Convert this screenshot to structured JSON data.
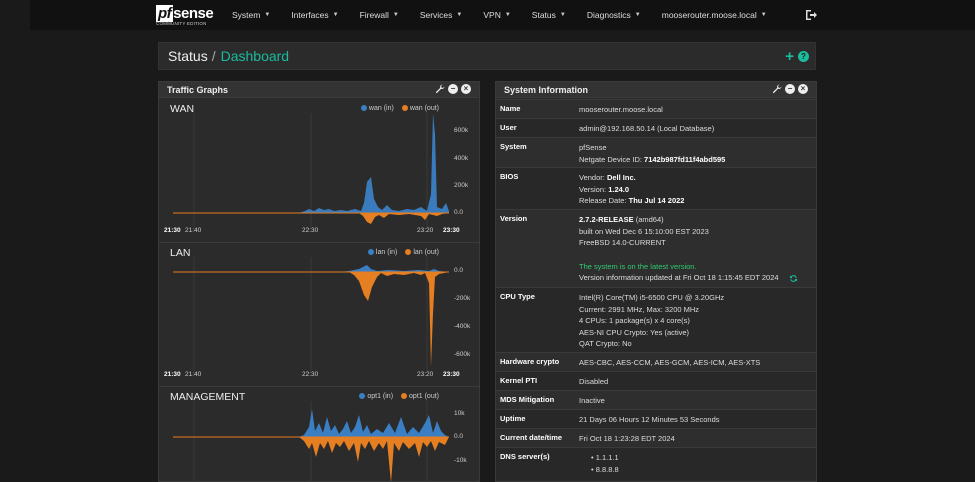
{
  "nav": {
    "logo_text": "sense",
    "logo_pf": "pf",
    "logo_sub": "COMMUNITY EDITION",
    "menu": [
      "System",
      "Interfaces",
      "Firewall",
      "Services",
      "VPN",
      "Status",
      "Diagnostics",
      "mooserouter.moose.local"
    ],
    "logout_icon": "sign-out-icon"
  },
  "breadcrumb": {
    "section": "Status",
    "separator": "/",
    "page": "Dashboard"
  },
  "traffic": {
    "title": "Traffic Graphs",
    "graphs": [
      {
        "name": "WAN",
        "legend_in": "wan (in)",
        "legend_out": "wan (out)",
        "yticks": [
          "600k",
          "400k",
          "200k",
          "0.0"
        ],
        "xticks": [
          "21:30",
          "21:40",
          "22:30",
          "23:20",
          "23:30"
        ]
      },
      {
        "name": "LAN",
        "legend_in": "lan (in)",
        "legend_out": "lan (out)",
        "yticks": [
          "0.0",
          "-200k",
          "-400k",
          "-600k"
        ],
        "xticks": [
          "21:30",
          "21:40",
          "22:30",
          "23:20",
          "23:30"
        ]
      },
      {
        "name": "MANAGEMENT",
        "legend_in": "opt1 (in)",
        "legend_out": "opt1 (out)",
        "yticks": [
          "10k",
          "0.0",
          "-10k"
        ],
        "xticks": []
      }
    ],
    "colors": {
      "in": "#3a7fc4",
      "out": "#e67e22"
    }
  },
  "sysinfo": {
    "title": "System Information",
    "rows": [
      {
        "label": "Name",
        "lines": [
          "mooserouter.moose.local"
        ]
      },
      {
        "label": "User",
        "lines": [
          "admin@192.168.50.14 (Local Database)"
        ]
      },
      {
        "label": "System",
        "lines": [
          "pfSense"
        ],
        "device_prefix": "Netgate Device ID: ",
        "device_id": "7142b987fd11f4abd595"
      },
      {
        "label": "BIOS",
        "vendor_prefix": "Vendor: ",
        "vendor": "Dell Inc.",
        "version_prefix": "Version: ",
        "version": "1.24.0",
        "date_prefix": "Release Date: ",
        "date": "Thu Jul 14 2022"
      },
      {
        "label": "Version",
        "release": "2.7.2-RELEASE",
        "arch": " (amd64)",
        "built": "built on Wed Dec 6 15:10:00 EST 2023",
        "os": "FreeBSD 14.0-CURRENT",
        "status": "The system is on the latest version.",
        "updated": "Version information updated at Fri Oct 18 1:15:45 EDT 2024"
      },
      {
        "label": "CPU Type",
        "lines": [
          "Intel(R) Core(TM) i5-6500 CPU @ 3.20GHz",
          "Current: 2991 MHz, Max: 3200 MHz",
          "4 CPUs: 1 package(s) x 4 core(s)",
          "AES-NI CPU Crypto: Yes (active)",
          "QAT Crypto: No"
        ]
      },
      {
        "label": "Hardware crypto",
        "lines": [
          "AES-CBC, AES-CCM, AES-GCM, AES-ICM, AES-XTS"
        ]
      },
      {
        "label": "Kernel PTI",
        "lines": [
          "Disabled"
        ]
      },
      {
        "label": "MDS Mitigation",
        "lines": [
          "Inactive"
        ]
      },
      {
        "label": "Uptime",
        "lines": [
          "21 Days 06 Hours 12 Minutes 53 Seconds"
        ]
      },
      {
        "label": "Current date/time",
        "lines": [
          "Fri Oct 18 1:23:28 EDT 2024"
        ]
      },
      {
        "label": "DNS server(s)",
        "dns": [
          "1.1.1.1",
          "8.8.8.8"
        ]
      }
    ]
  }
}
